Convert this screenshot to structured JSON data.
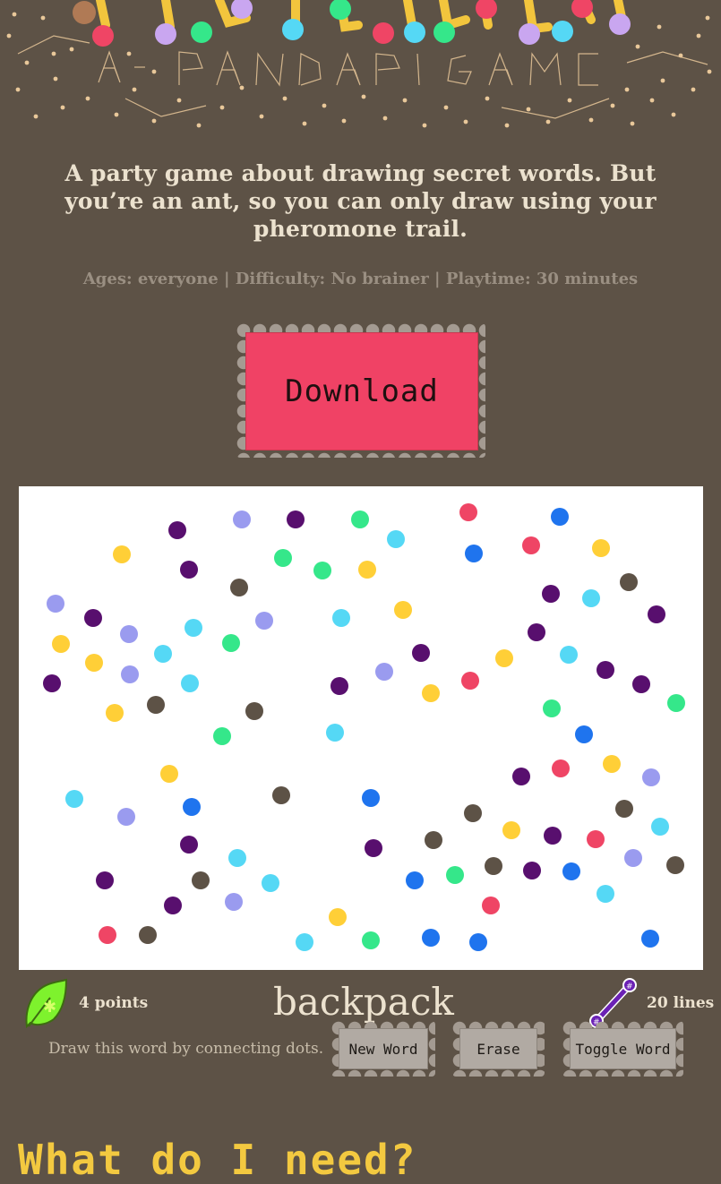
{
  "header": {
    "logo_subtitle": "A PANDADIC GAME"
  },
  "intro": {
    "tagline": "A party game about drawing secret words. But you’re an ant, so you can only draw using your pheromone trail.",
    "meta": "Ages: everyone | Difficulty: No brainer | Playtime: 30 minutes"
  },
  "download": {
    "label": "Download"
  },
  "game": {
    "points": "4 points",
    "word": "backpack",
    "lines": "20 lines",
    "hint": "Draw this word by connecting dots.",
    "buttons": {
      "new_word": "New Word",
      "erase": "Erase",
      "toggle_word": "Toggle Word"
    },
    "icons": {
      "points": "leaf-icon",
      "lines": "line-icon"
    },
    "line_marker": "#"
  },
  "colors": {
    "background": "#5d5246",
    "download": "#f04265",
    "dot_red": "#ef4565",
    "dot_purple": "#580f6e",
    "dot_lavender": "#9a9bef",
    "dot_green": "#35e78a",
    "dot_cyan": "#55d8f5",
    "dot_yellow": "#ffcf37",
    "dot_blue": "#1f74ee",
    "dot_brown": "#5d5246",
    "section_title": "#f3c940"
  },
  "next_section": {
    "title": "What do I need?"
  }
}
